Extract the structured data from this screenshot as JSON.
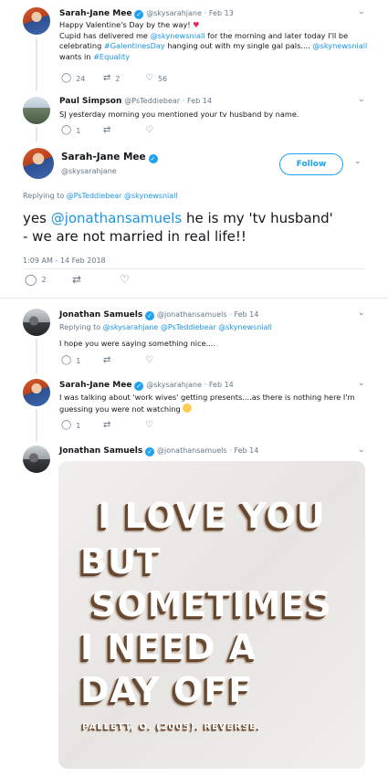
{
  "tweet1": {
    "name": "Sarah-Jane Mee",
    "handle": "@skysarahjane",
    "time": "· Feb 13",
    "line1": "Happy Valentine's Day by the way! ",
    "line2a": "Cupid has delivered me ",
    "mention1": "@skynewsniall",
    "line2b": " for the morning and later today I'll be",
    "line3a": "celebrating ",
    "hashtag1": "#GalentinesDay",
    "line3b": " hanging out with my single gal pals.... ",
    "mention2": "@skynewsniall",
    "line4a": "wants in ",
    "hashtag2": "#Equality",
    "replies": "24",
    "retweets": "2",
    "likes": "56"
  },
  "tweet2": {
    "name": "Paul Simpson",
    "handle": "@PsTeddiebear",
    "time": "· Feb 14",
    "text": "SJ  yesterday morning you mentioned your tv husband by name.",
    "replies": "1",
    "retweets": "",
    "likes": ""
  },
  "main": {
    "name": "Sarah-Jane Mee",
    "handle": "@skysarahjane",
    "follow": "Follow",
    "replying_to_prefix": "Replying to ",
    "replying_to_1": "@PsTeddiebear",
    "replying_to_2": "@skynewsniall",
    "text_a": "yes ",
    "text_mention": "@jonathansamuels",
    "text_b": "  he is my 'tv husband'",
    "text_line2": "- we are not married in real life!!",
    "timestamp": "1:09 AM - 14 Feb 2018",
    "replies": "2",
    "retweets": "",
    "likes": ""
  },
  "tweet3": {
    "name": "Jonathan Samuels",
    "handle": "@jonathansamuels",
    "time": "· Feb 14",
    "replying_to_prefix": "Replying to ",
    "replying_to": "@skysarahjane @PsTeddiebear @skynewsniall",
    "text": "I hope you were saying something nice....",
    "replies": "1",
    "retweets": "",
    "likes": ""
  },
  "tweet4": {
    "name": "Sarah-Jane Mee",
    "handle": "@skysarahjane",
    "time": "· Feb 14",
    "line1": "I was talking about 'work wives' getting presents....as there is nothing here I'm",
    "line2": "guessing you were not watching ",
    "replies": "1",
    "retweets": "",
    "likes": ""
  },
  "tweet5": {
    "name": "Jonathan Samuels",
    "handle": "@jonathansamuels",
    "time": "· Feb 14",
    "media_lines": [
      "I LOVE YOU",
      "BUT",
      "SOMETIMES",
      "I NEED A",
      "DAY OFF"
    ],
    "media_cite": "PALLETT, O. (2005). REVERSE."
  },
  "icons": {
    "reply": "reply-icon",
    "retweet": "retweet-icon",
    "like": "heart-icon",
    "verified": "verified-badge-icon",
    "chevron": "chevron-down-icon"
  },
  "colors": {
    "link": "#1b95e0",
    "verified": "#1da1f2",
    "heart": "#e0245e",
    "muted": "#657786"
  }
}
